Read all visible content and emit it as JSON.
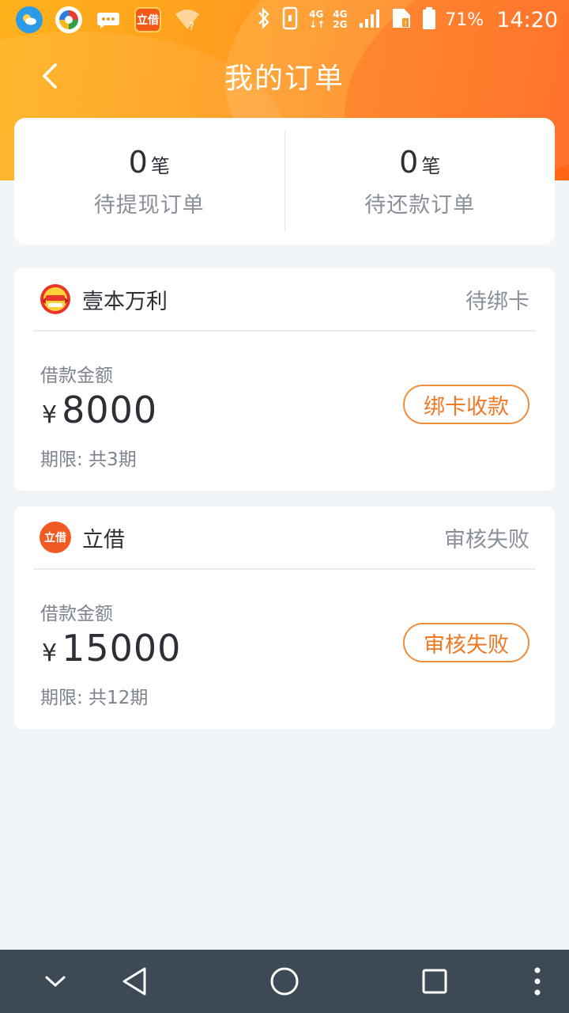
{
  "status_bar": {
    "battery": "71%",
    "time": "14:20",
    "network_top": "4G",
    "network_bottom": "4G 2G",
    "app_badge": "立借"
  },
  "nav": {
    "title": "我的订单"
  },
  "summary": {
    "withdraw": {
      "count": "0",
      "unit": "笔",
      "label": "待提现订单"
    },
    "repay": {
      "count": "0",
      "unit": "笔",
      "label": "待还款订单"
    }
  },
  "orders": [
    {
      "name": "壹本万利",
      "status": "待绑卡",
      "amount_label": "借款金额",
      "currency": "¥",
      "amount": "8000",
      "term": "期限: 共3期",
      "action": "绑卡收款"
    },
    {
      "name": "立借",
      "logo_text": "立借",
      "status": "审核失败",
      "amount_label": "借款金额",
      "currency": "¥",
      "amount": "15000",
      "term": "期限: 共12期",
      "action": "审核失败"
    }
  ],
  "colors": {
    "accent": "#ee7a26",
    "header_start": "#ffb21c",
    "header_end": "#ff6a1a",
    "navbar": "#3d4a56"
  }
}
